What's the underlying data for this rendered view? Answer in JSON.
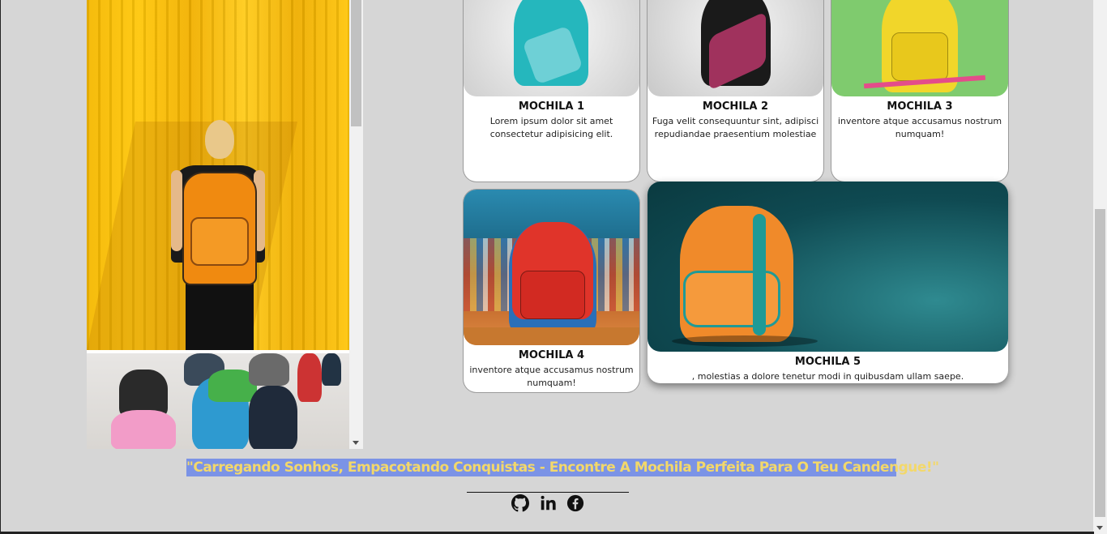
{
  "products": [
    {
      "title": "MOCHILA 1",
      "desc": "Lorem ipsum dolor sit amet consectetur adipisicing elit."
    },
    {
      "title": "MOCHILA 2",
      "desc": "Fuga velit consequuntur sint, adipisci repudiandae praesentium molestiae"
    },
    {
      "title": "MOCHILA 3",
      "desc": "inventore atque accusamus nostrum numquam!"
    },
    {
      "title": "MOCHILA 4",
      "desc": "inventore atque accusamus nostrum numquam!"
    },
    {
      "title": "MOCHILA 5",
      "desc": ", molestias a dolore tenetur modi in quibusdam ullam saepe."
    }
  ],
  "slogan": "\"Carregando Sonhos, Empacotando Conquistas - Encontre A Mochila Perfeita Para O Teu Candengue!\"",
  "social": [
    "github-icon",
    "linkedin-icon",
    "facebook-icon"
  ],
  "colors": {
    "slogan_bg": "#7b93e6",
    "slogan_text": "#f3d86a",
    "page_bg": "#d6d6d6"
  }
}
